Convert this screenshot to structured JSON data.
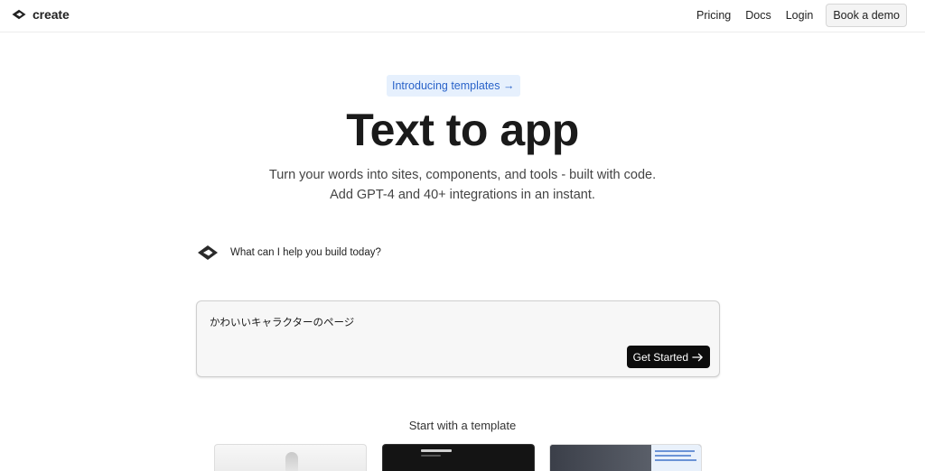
{
  "brand": {
    "name": "create",
    "logo_icon": "create-logo-icon"
  },
  "nav": {
    "links": [
      "Pricing",
      "Docs",
      "Login"
    ],
    "demo_button": "Book a demo"
  },
  "hero": {
    "badge": "Introducing templates →",
    "title": "Text to app",
    "subtitle_line1": "Turn your words into sites, components, and tools - built with code.",
    "subtitle_line2": "Add GPT-4 and 40+ integrations in an instant."
  },
  "assistant": {
    "prompt": "What can I help you build today?"
  },
  "prompt_box": {
    "value": "かわいいキャラクターのページ",
    "submit_label": "Get Started",
    "submit_icon": "arrow-right-icon"
  },
  "templates": {
    "heading": "Start with a template"
  },
  "colors": {
    "badge_bg": "#e6f0fd",
    "badge_text": "#2a63c9",
    "button_dark": "#0d0d0d"
  }
}
